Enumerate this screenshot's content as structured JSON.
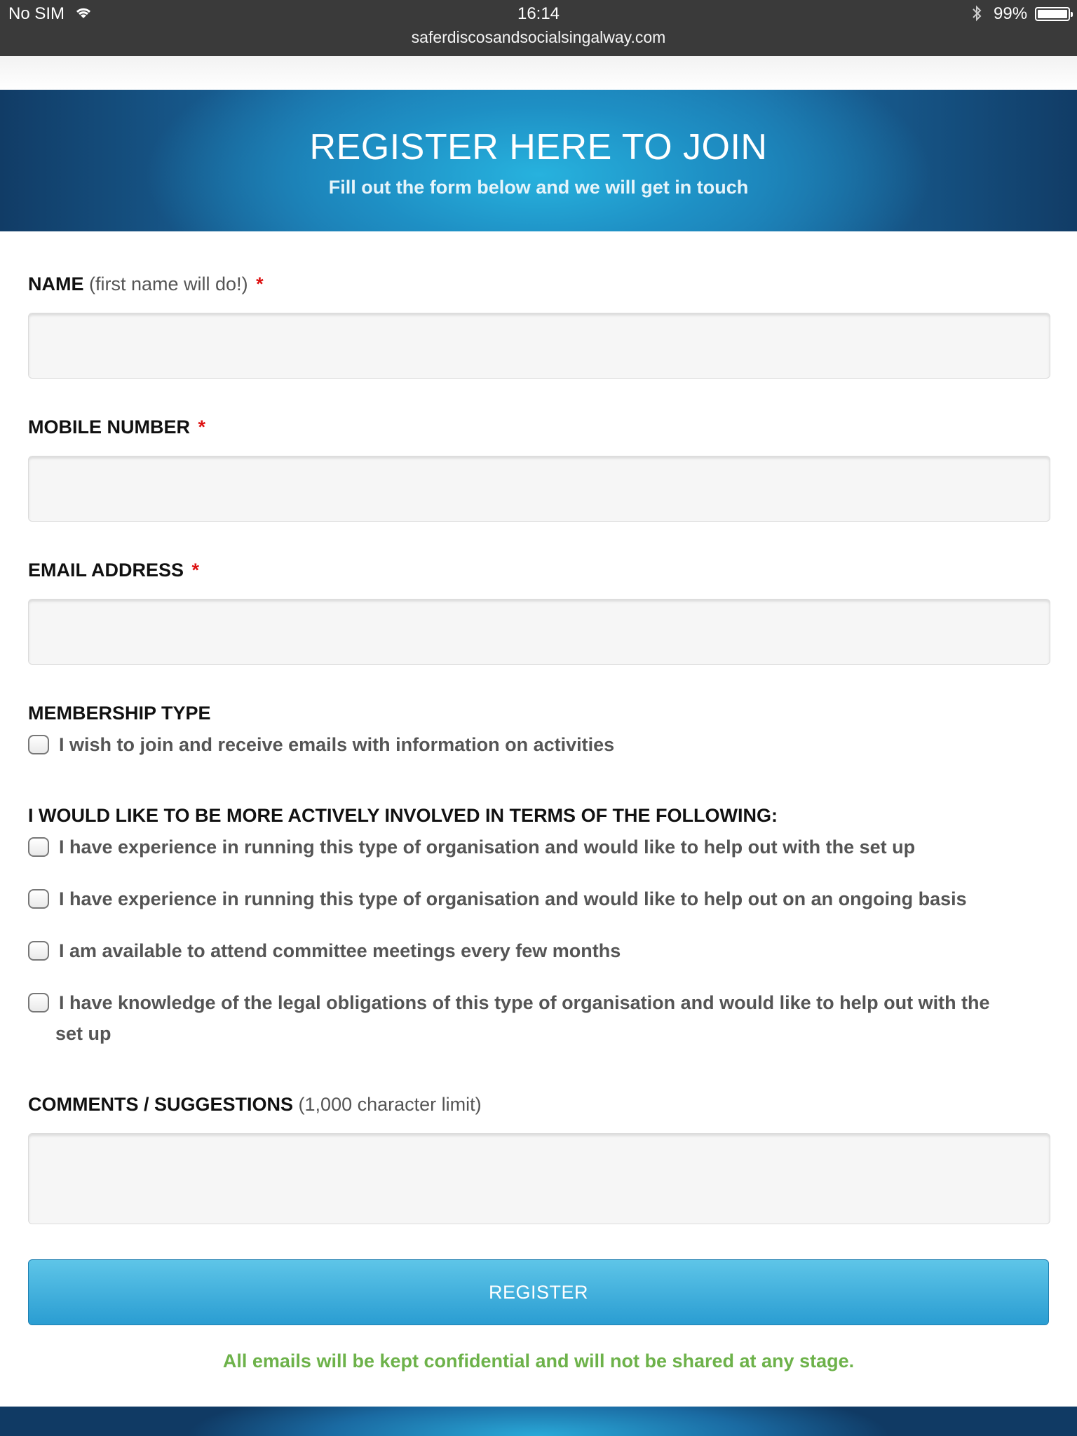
{
  "status_bar": {
    "carrier": "No SIM",
    "time": "16:14",
    "url": "saferdiscosandsocialsingalway.com",
    "battery": "99%",
    "icons": [
      "wifi-icon",
      "bluetooth-icon",
      "battery-icon"
    ]
  },
  "hero": {
    "title": "REGISTER HERE TO JOIN",
    "subtitle": "Fill out the form below and we will get in touch"
  },
  "form": {
    "name": {
      "label": "NAME",
      "hint": "(first name will do!)",
      "required": "*",
      "value": ""
    },
    "mobile": {
      "label": "MOBILE NUMBER",
      "required": "*",
      "value": ""
    },
    "email": {
      "label": "EMAIL ADDRESS",
      "required": "*",
      "value": ""
    },
    "membership": {
      "label": "MEMBERSHIP TYPE",
      "options": [
        {
          "text": "I wish to join and receive emails with information on activities",
          "checked": false
        }
      ]
    },
    "involvement": {
      "label": "I WOULD LIKE TO BE MORE ACTIVELY INVOLVED IN TERMS OF THE FOLLOWING:",
      "options": [
        {
          "text": "I have experience in running this type of organisation and would like to help out with the set up",
          "checked": false
        },
        {
          "text": "I have experience in running this type of organisation and would like to help out on an ongoing basis",
          "checked": false
        },
        {
          "text": "I am available to attend committee meetings every few months",
          "checked": false
        },
        {
          "text": "I have knowledge of the legal obligations of this type of organisation and would like to help out with the",
          "text_line2": "set up",
          "checked": false
        }
      ]
    },
    "comments": {
      "label": "COMMENTS / SUGGESTIONS",
      "hint": "(1,000 character limit)",
      "value": ""
    },
    "submit_label": "REGISTER",
    "privacy_note": "All emails will be kept confidential and will not be shared at any stage."
  },
  "colors": {
    "accent": "#2a9dd2",
    "required": "#dd1111",
    "note": "#6db24a",
    "hero": "#1e8fc4"
  }
}
